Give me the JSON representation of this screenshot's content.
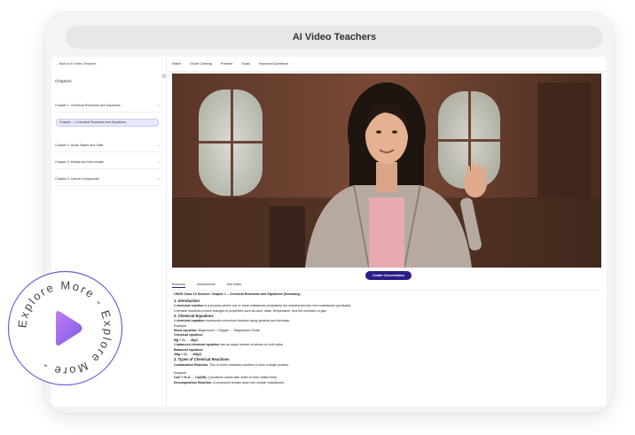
{
  "app": {
    "title": "AI Video Teachers"
  },
  "sidebar": {
    "back_link": "← Back to AI Video Teachers",
    "collapse_glyph": "‹",
    "title": "Chapters",
    "chapters": [
      {
        "label": "Chapter 1: Chemical Reactions and Equations",
        "chev": "^"
      },
      {
        "label": "Chapter 2: Acids, Bases and Salts",
        "chev": "^"
      },
      {
        "label": "Chapter 3: Metals and Non-metals",
        "chev": "^"
      },
      {
        "label": "Chapter 4: Carbon Compounds",
        "chev": "^"
      }
    ],
    "active_subitem": "Chapter - 1 Chemical Reactions and Equations"
  },
  "topnav": {
    "items": [
      "Watch",
      "Doubt Clearing",
      "Practice",
      "Goals",
      "Important Questions"
    ]
  },
  "video": {
    "action_label": "Create Conversation"
  },
  "tabs": {
    "items": [
      "Summary",
      "Assessments",
      "Add Notes"
    ],
    "active_index": 0
  },
  "summary": {
    "title": "CBSE Class 10 Science: Chapter 1 – Chemical Reactions and Equations (Summary)",
    "s1_heading": "1. Introduction",
    "s1_bold": "chemical reaction",
    "s1_pre": "A ",
    "s1_post": " is a process where one or more substances (reactants) are transformed into new substances (products).",
    "s1_line2": "Chemical reactions involve changes in properties such as color, state, temperature, and the evolution of gas.",
    "s2_heading": "2. Chemical Equations",
    "s2_pre": "A ",
    "s2_bold": "chemical equation",
    "s2_post": " represents a chemical reaction using symbols and formulas.",
    "example_label": "Example:",
    "word_eq_label": "Word equation:",
    "word_eq_value": " Magnesium + Oxygen → Magnesium Oxide",
    "chem_eq_label": "Chemical equation:",
    "chem_eq_value": "Mg + O₂ → MgO",
    "balanced_pre": "A ",
    "balanced_bold": "balanced chemical equation",
    "balanced_post": " has an equal number of atoms on both sides.",
    "balanced_label": "Balanced equation:",
    "balanced_value": "2Mg + O₂ → 2MgO",
    "s3_heading": "3. Types of Chemical Reactions",
    "comb_label": "Combination Reaction:",
    "comb_value": " Two or more reactants combine to form a single product.",
    "example2_label": "Example:",
    "example2_formula": "CaO + H₂O → Ca(OH)₂",
    "example2_note": " (Quicklime reacts with water to form slaked lime)",
    "decomp_label": "Decomposition Reaction:",
    "decomp_value": " A compound breaks down into simpler substances."
  },
  "badge": {
    "ring_text": "Explore More - Explore More - ",
    "icon": "play-icon"
  },
  "colors": {
    "primary": "#2a1d8a",
    "badge_play": "#9b6cf0",
    "badge_ring": "#6c63d8"
  }
}
